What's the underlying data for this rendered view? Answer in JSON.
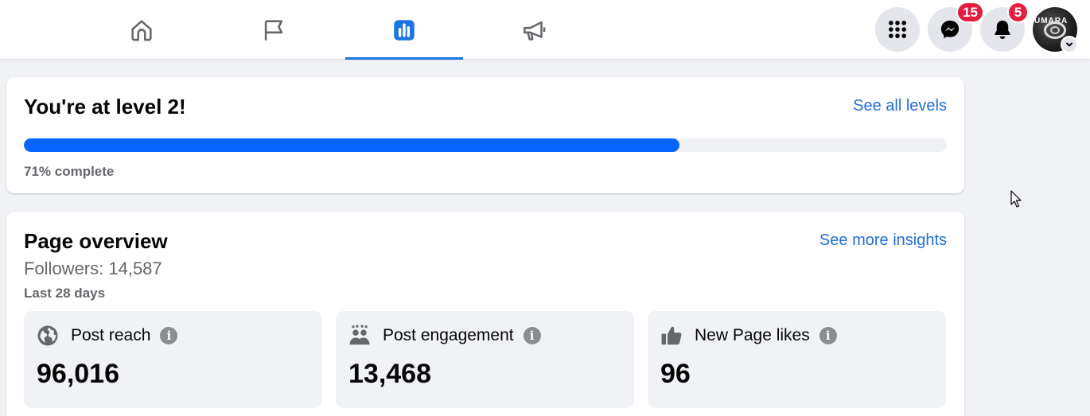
{
  "nav": {
    "tabs": [
      {
        "icon": "home-icon",
        "active": false
      },
      {
        "icon": "flag-icon",
        "active": false
      },
      {
        "icon": "insights-icon",
        "active": true
      },
      {
        "icon": "megaphone-icon",
        "active": false
      }
    ],
    "active_color": "#1b74e4"
  },
  "header": {
    "messenger_badge": "15",
    "notifications_badge": "5",
    "avatar_text": "UMARA"
  },
  "level": {
    "title": "You're at level 2!",
    "see_all_label": "See all levels",
    "progress_percent": 71,
    "progress_text": "71% complete"
  },
  "overview": {
    "title": "Page overview",
    "see_more_label": "See more insights",
    "followers_text": "Followers: 14,587",
    "period_text": "Last 28 days",
    "stats": [
      {
        "icon": "globe-icon",
        "label": "Post reach",
        "value": "96,016"
      },
      {
        "icon": "people-icon",
        "label": "Post engagement",
        "value": "13,468"
      },
      {
        "icon": "thumbs-up-icon",
        "label": "New Page likes",
        "value": "96"
      }
    ]
  },
  "colors": {
    "accent": "#0866ff",
    "link": "#216fdb",
    "badge": "#e41e3f"
  }
}
